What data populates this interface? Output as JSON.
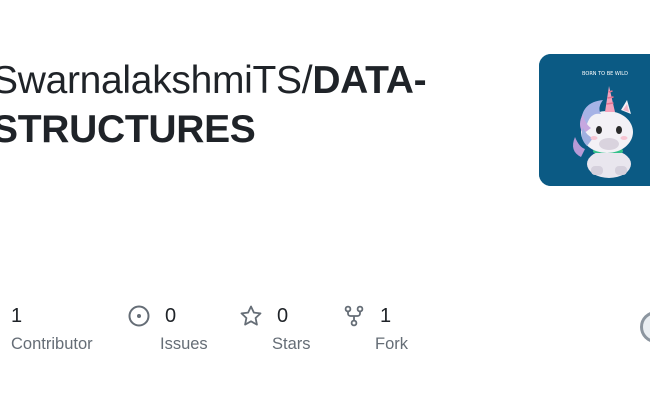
{
  "repo": {
    "owner_prefix": "SwarnalakshmiTS/",
    "name": "DATA-STRUCTURES",
    "name_part1": "DATA-",
    "name_part2": "STRUCTURES"
  },
  "avatar": {
    "caption": "BORN TO BE WILD",
    "background": "#0b5a84"
  },
  "stats": [
    {
      "value": "1",
      "label": "Contributor",
      "icon": "people-icon"
    },
    {
      "value": "0",
      "label": "Issues",
      "icon": "issue-opened-icon"
    },
    {
      "value": "0",
      "label": "Stars",
      "icon": "star-icon"
    },
    {
      "value": "1",
      "label": "Fork",
      "icon": "repo-forked-icon"
    }
  ],
  "colors": {
    "text": "#1f2328",
    "muted": "#656d76"
  }
}
